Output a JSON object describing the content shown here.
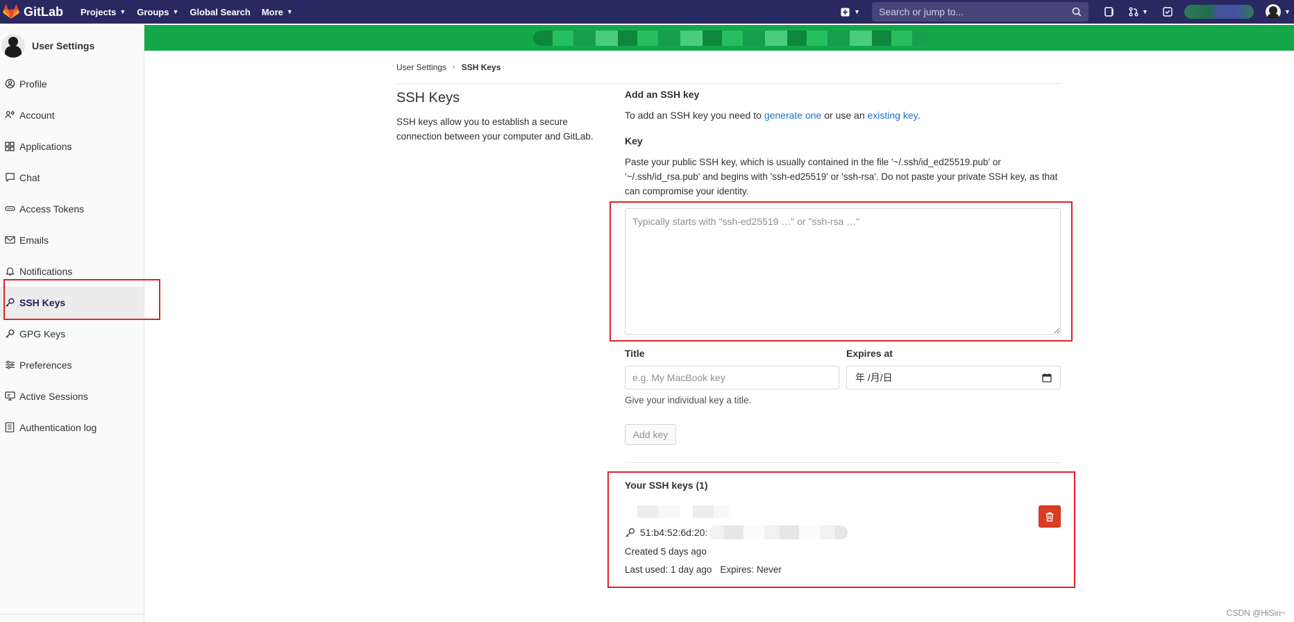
{
  "navbar": {
    "brand": "GitLab",
    "items": [
      {
        "label": "Projects",
        "dropdown": true
      },
      {
        "label": "Groups",
        "dropdown": true
      },
      {
        "label": "Global Search",
        "dropdown": false
      },
      {
        "label": "More",
        "dropdown": true
      }
    ],
    "search_placeholder": "Search or jump to...",
    "bg_color": "#292961"
  },
  "sidebar": {
    "title": "User Settings",
    "items": [
      {
        "label": "Profile",
        "icon": "profile-icon"
      },
      {
        "label": "Account",
        "icon": "account-icon"
      },
      {
        "label": "Applications",
        "icon": "applications-icon"
      },
      {
        "label": "Chat",
        "icon": "chat-icon"
      },
      {
        "label": "Access Tokens",
        "icon": "token-icon"
      },
      {
        "label": "Emails",
        "icon": "mail-icon"
      },
      {
        "label": "Notifications",
        "icon": "bell-icon"
      },
      {
        "label": "SSH Keys",
        "icon": "key-icon",
        "active": true
      },
      {
        "label": "GPG Keys",
        "icon": "key-icon"
      },
      {
        "label": "Preferences",
        "icon": "preferences-icon"
      },
      {
        "label": "Active Sessions",
        "icon": "monitor-icon"
      },
      {
        "label": "Authentication log",
        "icon": "log-icon"
      }
    ]
  },
  "banner": {
    "color": "#12a84a"
  },
  "breadcrumb": {
    "parent": "User Settings",
    "current": "SSH Keys"
  },
  "page": {
    "title": "SSH Keys",
    "description": "SSH keys allow you to establish a secure connection between your computer and GitLab."
  },
  "form": {
    "heading": "Add an SSH key",
    "intro_prefix": "To add an SSH key you need to",
    "intro_link1": "generate one",
    "intro_middle": "or use an",
    "intro_link2": "existing key",
    "intro_suffix": ".",
    "key_label": "Key",
    "key_description": "Paste your public SSH key, which is usually contained in the file '~/.ssh/id_ed25519.pub' or '~/.ssh/id_rsa.pub' and begins with 'ssh-ed25519' or 'ssh-rsa'. Do not paste your private SSH key, as that can compromise your identity.",
    "key_placeholder": "Typically starts with \"ssh-ed25519 …\" or \"ssh-rsa …\"",
    "title_label": "Title",
    "title_placeholder": "e.g. My MacBook key",
    "expires_label": "Expires at",
    "expires_value": "年 /月/日",
    "title_help": "Give your individual key a title.",
    "add_button": "Add key"
  },
  "keys": {
    "heading": "Your SSH keys (1)",
    "items": [
      {
        "fingerprint": "51:b4:52:6d:20:",
        "created": "Created 5 days ago",
        "last_used": "Last used: 1 day ago",
        "expires": "Expires: Never"
      }
    ]
  },
  "watermark": "CSDN @HiSiri~",
  "colors": {
    "link": "#1f6ec9",
    "danger": "#db3b21",
    "annotation": "#e0202a"
  }
}
